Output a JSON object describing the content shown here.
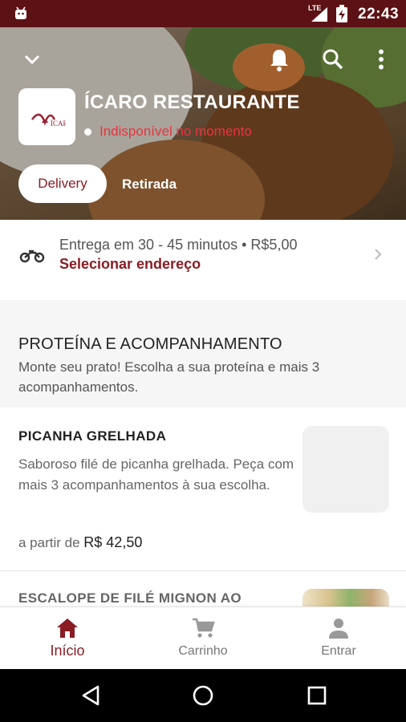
{
  "status_bar": {
    "network": "LTE",
    "time": "22:43"
  },
  "header": {
    "restaurant_name": "ÍCARO RESTAURANTE",
    "availability": "Indisponível no momento",
    "logo_text": "ÍCARO",
    "tabs": [
      "Delivery",
      "Retirada"
    ],
    "selected_tab": "Delivery"
  },
  "delivery_info": {
    "line": "Entrega em 30 - 45 minutos • R$5,00",
    "action": "Selecionar endereço"
  },
  "section": {
    "title": "PROTEÍNA E ACOMPANHAMENTO",
    "description": "Monte seu prato! Escolha a sua proteína e mais 3 acompanhamentos."
  },
  "products": [
    {
      "name": "PICANHA GRELHADA",
      "description": "Saboroso filé de picanha grelhada. Peça com mais 3 acompanhamentos à sua escolha.",
      "price_prefix": "a partir de",
      "price": "R$ 42,50"
    },
    {
      "name": "ESCALOPE DE FILÉ MIGNON AO"
    }
  ],
  "bottom_nav": [
    {
      "label": "Início",
      "icon": "home-icon",
      "active": true
    },
    {
      "label": "Carrinho",
      "icon": "cart-icon",
      "active": false
    },
    {
      "label": "Entrar",
      "icon": "person-icon",
      "active": false
    }
  ],
  "colors": {
    "status_bar": "#5c1115",
    "brand": "#8a1c24",
    "unavailable": "#e8343f"
  }
}
